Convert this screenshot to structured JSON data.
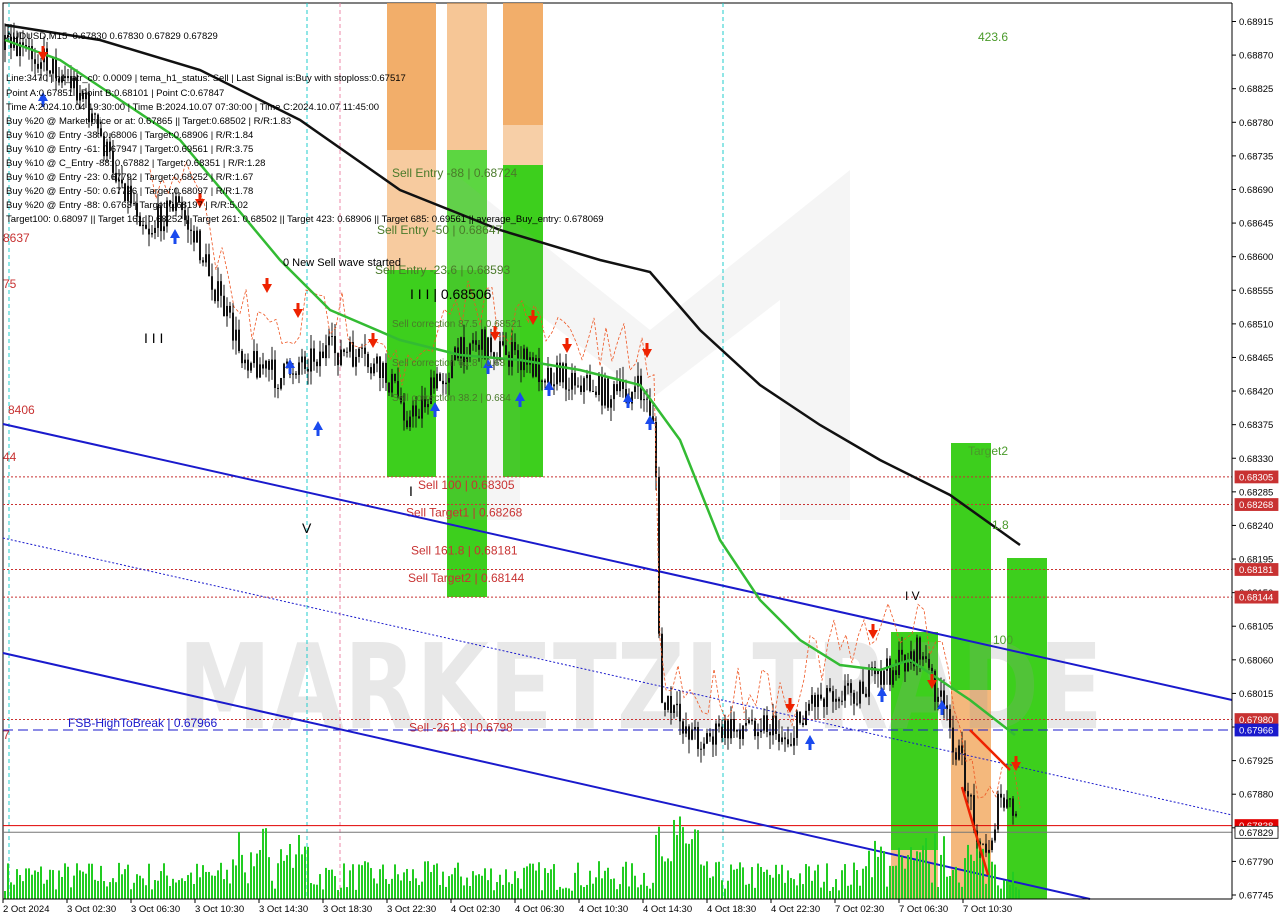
{
  "chart_data": {
    "type": "candlestick",
    "symbol_line": "AUDUSD,M15  0.67830 0.67830 0.67829 0.67829",
    "info_lines": [
      "Line:3470 | h1_atr_c0: 0.0009 | tema_h1_status: Sell | Last Signal is:Buy with stoploss:0.67517",
      "Point A:0.67851 | Point B:0.68101 | Point C:0.67847",
      "Time A:2024.10.04 19:30:00 | Time B:2024.10.07 07:30:00 | Time C:2024.10.07 11:45:00",
      "Buy %20 @ Market price or at: 0.67865 || Target:0.68502 | R/R:1.83",
      "Buy %10 @ Entry -38: 0.68006 | Target:0.68906 | R/R:1.84",
      "Buy %10 @ Entry -61: 0.67947 | Target:0.69561 | R/R:3.75",
      "Buy %10 @ C_Entry -88: 0.67882 | Target:0.68351 | R/R:1.28",
      "Buy %10 @ Entry -23: 0.67792 | Target:0.68252 | R/R:1.67",
      "Buy %20 @ Entry -50: 0.67726 | Target:0.68097 | R/R:1.78",
      "Buy %20 @ Entry -88: 0.6763 | Target:0.68197 | R/R:5.02",
      "Target100: 0.68097 || Target 161: 0.68252 || Target 261: 0.68502 || Target 423: 0.68906 || Target 685: 0.69561 || average_Buy_entry: 0.678069"
    ],
    "y_ticks": [
      "0.68915",
      "0.68870",
      "0.68825",
      "0.68780",
      "0.68735",
      "0.68690",
      "0.68645",
      "0.68600",
      "0.68555",
      "0.68510",
      "0.68465",
      "0.68420",
      "0.68375",
      "0.68330",
      "0.68285",
      "0.68240",
      "0.68195",
      "0.68150",
      "0.68105",
      "0.68060",
      "0.68015",
      "0.67970",
      "0.67925",
      "0.67880",
      "0.67835",
      "0.67790",
      "0.67745"
    ],
    "ylim": [
      0.67745,
      0.68935
    ],
    "x_ticks": [
      "2 Oct 2024",
      "3 Oct 02:30",
      "3 Oct 06:30",
      "3 Oct 10:30",
      "3 Oct 14:30",
      "3 Oct 18:30",
      "3 Oct 22:30",
      "4 Oct 02:30",
      "4 Oct 06:30",
      "4 Oct 10:30",
      "4 Oct 14:30",
      "4 Oct 18:30",
      "4 Oct 22:30",
      "7 Oct 02:30",
      "7 Oct 06:30",
      "7 Oct 10:30"
    ],
    "levels": [
      {
        "label": "Sell 100 | 0.68305",
        "value": 0.68305,
        "tag": "0.68305",
        "color": "#c83232",
        "style": "dotted"
      },
      {
        "label": "Sell Target1 | 0.68268",
        "value": 0.68268,
        "tag": "0.68268",
        "color": "#c83232",
        "style": "dotted"
      },
      {
        "label": "Sell 161.8 | 0.68181",
        "value": 0.68181,
        "tag": "0.68181",
        "color": "#c83232",
        "style": "dotted"
      },
      {
        "label": "Sell Target2 | 0.68144",
        "value": 0.68144,
        "tag": "0.68144",
        "color": "#c83232",
        "style": "dotted"
      },
      {
        "label": "Sell -261.8 | 0.6798",
        "value": 0.6798,
        "tag": "0.67980",
        "color": "#c83232",
        "style": "dotted"
      },
      {
        "label": "FSB-HighToBreak | 0.67966",
        "value": 0.67966,
        "tag": "0.67966",
        "color": "#1a1acc",
        "style": "dashed"
      },
      {
        "label": "",
        "value": 0.67838,
        "tag": "0.67838",
        "color": "#e00000",
        "style": "solid"
      },
      {
        "label": "",
        "value": 0.67829,
        "tag": "0.67829",
        "color": "#777777",
        "style": "solid"
      }
    ],
    "zone_labels": [
      {
        "text": "Sell Entry -88 | 0.68724",
        "color": "#4a7a2a"
      },
      {
        "text": "Sell Entry -50 | 0.68647",
        "color": "#4a7a2a"
      },
      {
        "text": "Sell Entry -23.6 | 0.68593",
        "color": "#4a7a2a"
      },
      {
        "text": "I I I | 0.68506",
        "color": "#000000"
      },
      {
        "text": "Sell correction 87.5 | 0.68521",
        "color": "#4a7a2a"
      },
      {
        "text": "Sell correction 61.8 | 0.68",
        "color": "#4a7a2a"
      },
      {
        "text": "Sell correction 38.2 | 0.684",
        "color": "#4a7a2a"
      },
      {
        "text": "0 New Sell wave started",
        "color": "#000000"
      },
      {
        "text": "423.6",
        "color": "#4a9a2a"
      },
      {
        "text": "Target2",
        "color": "#4a9a2a"
      },
      {
        "text": "1.8",
        "color": "#4a9a2a"
      },
      {
        "text": "100",
        "color": "#4a9a2a"
      },
      {
        "text": "I V",
        "color": "#000000"
      },
      {
        "text": "V",
        "color": "#000000"
      },
      {
        "text": "I I I",
        "color": "#000000"
      },
      {
        "text": "I",
        "color": "#000000"
      }
    ],
    "left_partial_labels": [
      "8637",
      "75",
      "8406",
      "44",
      "7"
    ],
    "watermark": "MARKETZI TRADE",
    "colors": {
      "zone_orange": "#f0a050",
      "zone_green": "#33cc11",
      "ma_green": "#33bb33",
      "ma_black": "#111111",
      "channel_blue": "#1a1acc",
      "sell_red": "#ee2200",
      "buy_blue": "#1a4aee",
      "volume_green": "#22cc22",
      "vline_cyan": "#22cccc",
      "vline_pink": "#ee88aa",
      "bar_color": "#111111"
    }
  }
}
